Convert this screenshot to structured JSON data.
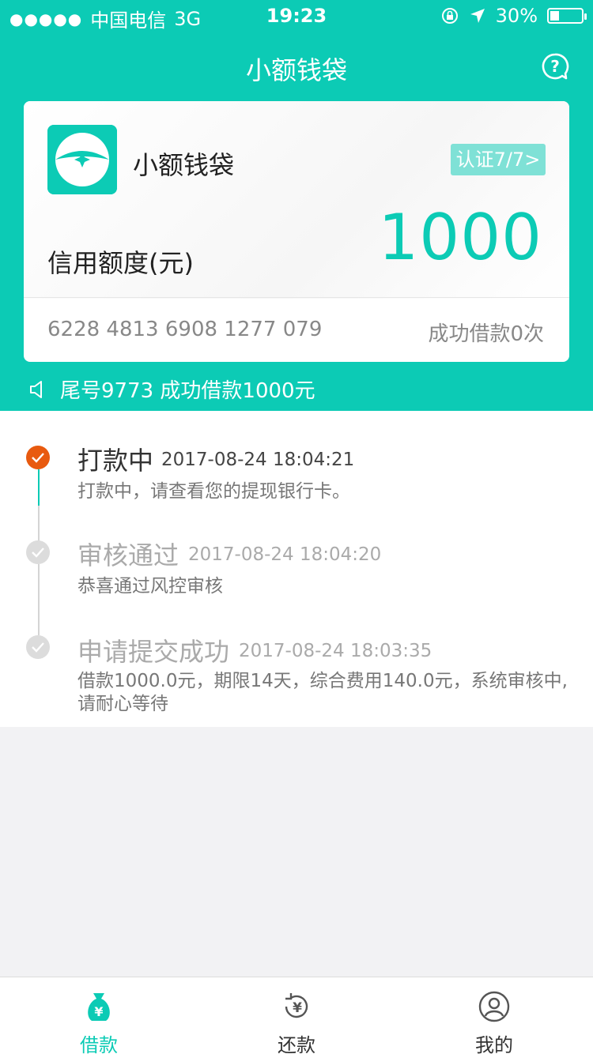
{
  "status_bar": {
    "carrier": "中国电信",
    "network": "3G",
    "time": "19:23",
    "battery_text": "30%",
    "battery_level": 0.3
  },
  "nav": {
    "title": "小额钱袋",
    "help_icon": "help-icon"
  },
  "card": {
    "name": "小额钱袋",
    "cert_label": "认证7/7>",
    "credit_label": "信用额度(元)",
    "credit_amount": "1000",
    "card_number": "6228 4813 6908 1277 079",
    "success_count": "成功借款0次"
  },
  "notice": {
    "text": "尾号9773 成功借款1000元"
  },
  "timeline": [
    {
      "title": "打款中",
      "time": "2017-08-24 18:04:21",
      "desc": "打款中，请查看您的提现银行卡。",
      "state": "active"
    },
    {
      "title": "审核通过",
      "time": "2017-08-24 18:04:20",
      "desc": "恭喜通过风控审核",
      "state": "done"
    },
    {
      "title": "申请提交成功",
      "time": "2017-08-24 18:03:35",
      "desc": "借款1000.0元，期限14天，综合费用140.0元，系统审核中,请耐心等待",
      "state": "done"
    }
  ],
  "tabbar": [
    {
      "label": "借款",
      "icon": "money-bag-icon",
      "active": true
    },
    {
      "label": "还款",
      "icon": "repay-yen-icon",
      "active": false
    },
    {
      "label": "我的",
      "icon": "user-profile-icon",
      "active": false
    }
  ],
  "colors": {
    "accent": "#0ccbb5",
    "active_dot": "#e85a0f"
  }
}
